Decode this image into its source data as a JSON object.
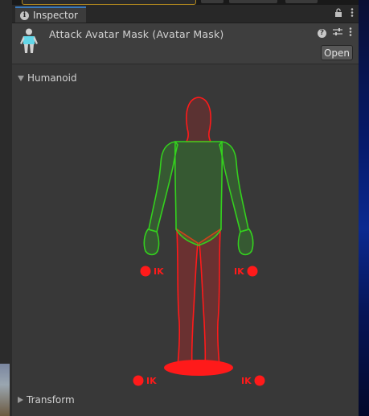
{
  "tab": {
    "title": "Inspector",
    "icon": "info-icon"
  },
  "tab_actions": {
    "lock": "lock-icon",
    "menu": "more-vert-icon"
  },
  "asset": {
    "title": "Attack Avatar Mask (Avatar Mask)",
    "icon": "avatar-mask-icon"
  },
  "header_actions": {
    "help": "?",
    "settings": "sliders-icon",
    "menu": "more-vert-icon",
    "open_label": "Open"
  },
  "humanoid": {
    "label": "Humanoid",
    "expanded": true,
    "ik_label": "IK",
    "colors": {
      "enabled": "#34d11e",
      "disabled": "#ff1a1a"
    },
    "parts": [
      {
        "name": "head",
        "state": "disabled"
      },
      {
        "name": "body",
        "state": "enabled"
      },
      {
        "name": "left-arm",
        "state": "enabled"
      },
      {
        "name": "right-arm",
        "state": "enabled"
      },
      {
        "name": "left-hand",
        "state": "enabled"
      },
      {
        "name": "right-hand",
        "state": "enabled"
      },
      {
        "name": "left-leg",
        "state": "disabled"
      },
      {
        "name": "right-leg",
        "state": "disabled"
      },
      {
        "name": "root",
        "state": "disabled"
      },
      {
        "name": "left-hand-ik",
        "state": "disabled"
      },
      {
        "name": "right-hand-ik",
        "state": "disabled"
      },
      {
        "name": "left-foot-ik",
        "state": "disabled"
      },
      {
        "name": "right-foot-ik",
        "state": "disabled"
      }
    ]
  },
  "transform": {
    "label": "Transform",
    "expanded": false
  }
}
